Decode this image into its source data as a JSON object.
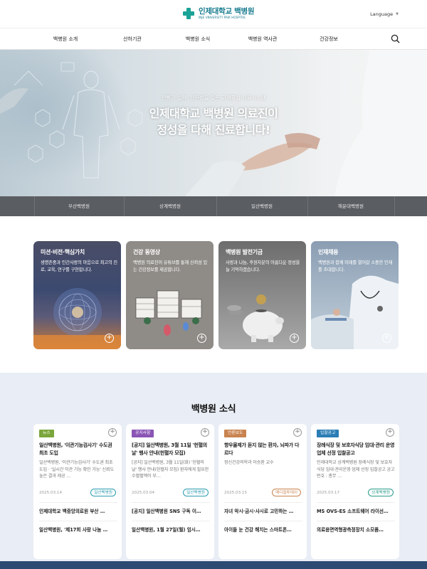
{
  "header": {
    "logo_ko": "인제대학교 백병원",
    "logo_en": "INJE UNIVERSITY PAIK HOSPITAL",
    "language": "Language"
  },
  "nav": {
    "items": [
      "백병원 소개",
      "산하기관",
      "백병원 소식",
      "백병원 역사관",
      "건강정보"
    ]
  },
  "hero": {
    "subtitle": "전통과 실력, 전문성을 갖춘 고객중심 진료시스템",
    "title_line1": "인제대학교 백병원 의료진이",
    "title_line2": "정성을 다해 진료합니다!"
  },
  "hospitals": [
    "부산백병원",
    "상계백병원",
    "일산백병원",
    "해운대백병원"
  ],
  "cards": [
    {
      "title": "미션·비전·핵심가치",
      "desc": "생명존중과 인간사랑의 마음으로 최고의 진료, 교육, 연구를 구현합니다."
    },
    {
      "title": "건강 동영상",
      "desc": "백병원 의료진이 유튜브를 통해 신뢰성 있는 건강정보를 제공합니다."
    },
    {
      "title": "백병원 발전기금",
      "desc": "사랑과 나눔, 후원자분의 아름다운 정성을 늘 기억하겠습니다."
    },
    {
      "title": "인재채용",
      "desc": "백병원과 함께 미래를 열어갈 소중한 인재를 초대합니다."
    }
  ],
  "news": {
    "title": "백병원 소식",
    "cards": [
      {
        "badge": "뉴스",
        "badge_color": "#7aa63c",
        "headline": "일산백병원, '이관기능검사기' 수도권 최초 도입",
        "body": "일산백병원, '이관기능검사기' 수도권 최초 도입 · '실시간 이관 기능 확인 가능' 신뢰도 높은 결과 제공 …",
        "date": "2025.03.14",
        "source": "일산백병원",
        "source_color": "#2a9bb0",
        "line1": "인제대학교 백중앙의료원 부산 …",
        "line2": "일산백병원, '제17회 사랑 나눔 …"
      },
      {
        "badge": "공지사항",
        "badge_color": "#8a55b5",
        "headline": "[공지] 일산백병원, 3월 11일 '헌혈의 날' 행사 안내(헌혈자 모집)",
        "body": "[공지] 일산백병원, 3월 11일(화) '헌혈의 날' 행사 안내(헌혈자 모집) 환자에게 필요한 수혈혈액이 부…",
        "date": "2025.03.04",
        "source": "일산백병원",
        "source_color": "#2a9bb0",
        "line1": "[공지] 일산백병원 SNS 구독 이…",
        "line2": "일산백병원, 1월 27일(월) 임시…"
      },
      {
        "badge": "언론보도",
        "badge_color": "#c9834f",
        "headline": "향우울제가 듣지 않는 환자, 뇌파가 다르다",
        "body": "정신건강의학과 이승환 교수",
        "date": "2025.03.15",
        "source": "메디컬투데이",
        "source_color": "#c9834f",
        "line1": "자녀 악시·금시·사시로 고민하는 …",
        "line2": "아이들 눈 건강 해치는 스마트폰…"
      },
      {
        "badge": "입찰공고",
        "badge_color": "#2a7db5",
        "headline": "장례식장 및 보호자식당 임대·관리 운영 업체 선정 입찰공고",
        "body": "인제대학교 상계백병원 장례식장 및 보호자식당 임대·관리운영 업체 선정 입찰공고 공고번호 : 총무 …",
        "date": "2025.03.17",
        "source": "상계백병원",
        "source_color": "#2a9b8a",
        "line1": "MS OVS-ES 소프트웨어 라이선…",
        "line2": "의료용면역형광측정장치 소모품…"
      }
    ]
  }
}
